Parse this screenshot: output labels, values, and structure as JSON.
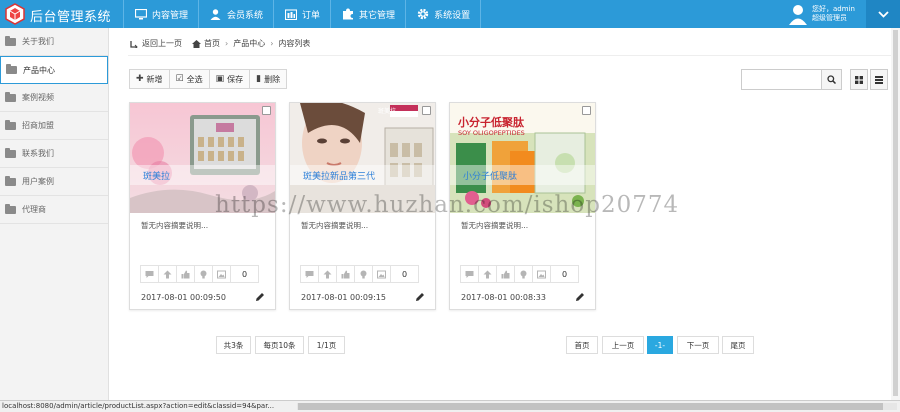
{
  "app": {
    "title": "后台管理系统"
  },
  "nav": [
    {
      "label": "内容管理",
      "icon": "monitor-icon"
    },
    {
      "label": "会员系统",
      "icon": "user-icon"
    },
    {
      "label": "订单",
      "icon": "orders-icon"
    },
    {
      "label": "其它管理",
      "icon": "puzzle-icon"
    },
    {
      "label": "系统设置",
      "icon": "gear-icon"
    }
  ],
  "user": {
    "greeting": "您好，admin",
    "role": "超级管理员"
  },
  "sidebar": {
    "items": [
      {
        "label": "关于我们",
        "active": false
      },
      {
        "label": "产品中心",
        "active": true
      },
      {
        "label": "案例视频",
        "active": false
      },
      {
        "label": "招商加盟",
        "active": false
      },
      {
        "label": "联系我们",
        "active": false
      },
      {
        "label": "用户案例",
        "active": false
      },
      {
        "label": "代理商",
        "active": false
      }
    ]
  },
  "breadcrumb": {
    "back": "返回上一页",
    "home": "首页",
    "section": "产品中心",
    "current": "内容列表"
  },
  "toolbar": {
    "add": "新增",
    "select_all": "全选",
    "save": "保存",
    "delete": "删除"
  },
  "search": {
    "placeholder": ""
  },
  "cards": [
    {
      "title": "斑美拉",
      "summary": "暂无内容摘要说明...",
      "count": "0",
      "date": "2017-08-01 00:09:50"
    },
    {
      "title": "斑美拉新品第三代",
      "summary": "暂无内容摘要说明...",
      "count": "0",
      "date": "2017-08-01 00:09:15"
    },
    {
      "title": "小分子低聚肽",
      "summary": "暂无内容摘要说明...",
      "count": "0",
      "date": "2017-08-01 00:08:33"
    }
  ],
  "card3_image_text": "小分子低聚肽",
  "card3_image_sub": "SOY OLIGOPEPTIDES",
  "card2_image_badge": "斑美拉",
  "pagination": {
    "total": "共3条",
    "per_page": "每页10条",
    "pages": "1/1页",
    "first": "首页",
    "prev": "上一页",
    "current": "-1-",
    "next": "下一页",
    "last": "尾页"
  },
  "status": {
    "url": "localhost:8080/admin/article/productList.aspx?action=edit&classid=94&par..."
  },
  "watermark": "https://www.huzhan.com/ishop20774",
  "colors": {
    "header": "#2c9ad8",
    "accent": "#2aa8e0",
    "title_link": "#2c7fd8"
  }
}
